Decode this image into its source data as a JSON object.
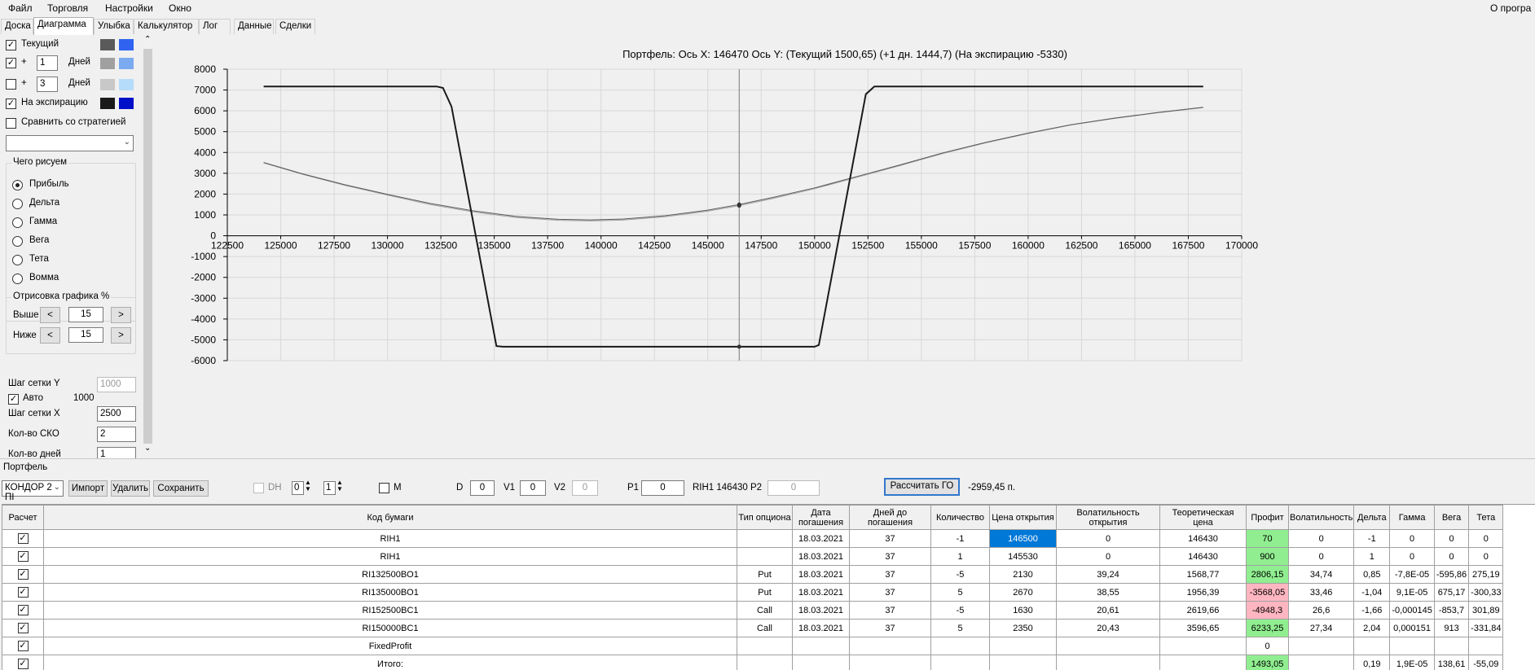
{
  "menu": {
    "items": [
      "Файл",
      "Торговля",
      "Настройки",
      "Окно"
    ],
    "right_text": "О програ"
  },
  "tabs": [
    "Доска",
    "Диаграмма",
    "Улыбка",
    "Калькулятор",
    "Лог",
    "Данные",
    "Сделки"
  ],
  "active_tab": "Диаграмма",
  "left": {
    "current_label": "Текущий",
    "plus_label": "+",
    "days_label": "Дней",
    "days1_value": "1",
    "days2_value": "3",
    "expiry_label": "На экспирацию",
    "compare_label": "Сравнить со стратегией",
    "strategy_combo_value": "",
    "what_group_title": "Чего рисуем",
    "radios": [
      "Прибыль",
      "Дельта",
      "Гамма",
      "Вега",
      "Тета",
      "Вомма"
    ],
    "radio_selected": "Прибыль",
    "draw_group_title": "Отрисовка графика %",
    "above_label": "Выше",
    "below_label": "Ниже",
    "above_value": "15",
    "below_value": "15",
    "dec_glyph": "<",
    "inc_glyph": ">",
    "grid_y_label": "Шаг сетки Y",
    "grid_y_value": "1000",
    "auto_label": "Авто",
    "auto_value": "1000",
    "grid_x_label": "Шаг сетки X",
    "grid_x_value": "2500",
    "sko_label": "Кол-во СКО",
    "sko_value": "2",
    "days_count_label": "Кол-во дней",
    "days_count_value": "1",
    "colors": {
      "current_dark": "#5a5a5a",
      "current_light": "#2f63f0",
      "plus1_dark": "#a0a0a0",
      "plus1_light": "#7aaaf0",
      "plus3_dark": "#c8c8c8",
      "plus3_light": "#b5dcfa",
      "expiry_dark": "#1a1a1a",
      "expiry_light": "#0010c8"
    }
  },
  "chart_title": "Портфель: Ось X: 146470 Ось Y:  (Текущий 1500,65)  (+1 дн. 1444,7)  (На экспирацию -5330)",
  "chart_data": {
    "type": "line",
    "xlim": [
      122500,
      170000
    ],
    "ylim": [
      -6000,
      8000
    ],
    "x_ticks": [
      122500,
      125000,
      127500,
      130000,
      132500,
      135000,
      137500,
      140000,
      142500,
      145000,
      147500,
      150000,
      152500,
      155000,
      157500,
      160000,
      162500,
      165000,
      167500,
      170000
    ],
    "y_ticks": [
      8000,
      7000,
      6000,
      5000,
      4000,
      3000,
      2000,
      1000,
      0,
      -1000,
      -2000,
      -3000,
      -4000,
      -5000,
      -6000
    ],
    "x_tick_labels": [
      "122500",
      "125000",
      "127500",
      "130000",
      "132500",
      "135000",
      "137500",
      "140000",
      "142500",
      "145000",
      "147500",
      "150000",
      "152500",
      "155000",
      "157500",
      "160000",
      "162500",
      "165000",
      "167500",
      "170000"
    ],
    "y_tick_labels": [
      "8000",
      "7000",
      "6000",
      "5000",
      "4000",
      "3000",
      "2000",
      "1000",
      "0",
      "-1000",
      "-2000",
      "-3000",
      "-4000",
      "-5000",
      "-6000"
    ],
    "grid": true,
    "cursor_x": 146470,
    "series": [
      {
        "color": "#1a1a1a",
        "width": 2,
        "x": [
          124200,
          132300,
          132600,
          133000,
          135100,
          135400,
          150000,
          150200,
          152400,
          152800,
          153200,
          168200
        ],
        "y": [
          7170,
          7170,
          7100,
          6200,
          -5300,
          -5330,
          -5330,
          -5250,
          6800,
          7170,
          7170,
          7170
        ]
      },
      {
        "color": "#5a5a5a",
        "width": 1,
        "x": [
          124200,
          126000,
          128000,
          130000,
          132000,
          134000,
          136000,
          138000,
          139500,
          141000,
          143000,
          145000,
          146470,
          148000,
          150000,
          152000,
          154000,
          156000,
          158000,
          160000,
          162000,
          164000,
          166000,
          168200
        ],
        "y": [
          3520,
          2980,
          2450,
          1990,
          1550,
          1200,
          930,
          790,
          760,
          800,
          960,
          1230,
          1500,
          1830,
          2300,
          2850,
          3400,
          3980,
          4480,
          4930,
          5330,
          5640,
          5910,
          6170
        ]
      },
      {
        "color": "#a0a0a0",
        "width": 1,
        "x": [
          124200,
          126000,
          128000,
          130000,
          132000,
          134000,
          136000,
          138000,
          139500,
          141000,
          143000,
          145000,
          146470,
          148000,
          150000,
          152000,
          154000,
          156000,
          158000,
          160000,
          162000,
          164000,
          166000,
          168200
        ],
        "y": [
          3500,
          2960,
          2420,
          1950,
          1500,
          1150,
          880,
          740,
          710,
          750,
          910,
          1180,
          1445,
          1780,
          2260,
          2810,
          3370,
          3950,
          4460,
          4910,
          5320,
          5630,
          5900,
          6160
        ]
      }
    ]
  },
  "portfolio_label": "Портфель",
  "toolbar": {
    "portfolio_combo": "КОНДОР 2 ПІ",
    "import_label": "Импорт",
    "delete_label": "Удалить",
    "save_label": "Сохранить",
    "dh_label": "DH",
    "dh_val1": "0",
    "dh_val2": "1",
    "m_label": "M",
    "d_label": "D",
    "d_value": "0",
    "v1_label": "V1",
    "v1_value": "0",
    "v2_label": "V2",
    "v2_value": "0",
    "p1_label": "P1",
    "p1_value": "0",
    "rih_text": "RIH1 146430",
    "p2_label": "P2",
    "p2_value": "0",
    "calc_label": "Рассчитать ГО",
    "go_value": "-2959,45 п."
  },
  "table": {
    "headers": [
      "Расчет",
      "Код бумаги",
      "Тип опциона",
      "Дата погашения",
      "Дней до погашения",
      "Количество",
      "Цена открытия",
      "Волатильность открытия",
      "Теоретическая цена",
      "Профит",
      "Волатильность",
      "Дельта",
      "Гамма",
      "Вега",
      "Тета"
    ],
    "rows": [
      [
        "✓",
        "RIH1",
        "",
        "18.03.2021",
        "37",
        "-1",
        "146500",
        "0",
        "146430",
        "70",
        "0",
        "-1",
        "0",
        "0",
        "0"
      ],
      [
        "✓",
        "RIH1",
        "",
        "18.03.2021",
        "37",
        "1",
        "145530",
        "0",
        "146430",
        "900",
        "0",
        "1",
        "0",
        "0",
        "0"
      ],
      [
        "✓",
        "RI132500BO1",
        "Put",
        "18.03.2021",
        "37",
        "-5",
        "2130",
        "39,24",
        "1568,77",
        "2806,15",
        "34,74",
        "0,85",
        "-7,8E-05",
        "-595,86",
        "275,19"
      ],
      [
        "✓",
        "RI135000BO1",
        "Put",
        "18.03.2021",
        "37",
        "5",
        "2670",
        "38,55",
        "1956,39",
        "-3568,05",
        "33,46",
        "-1,04",
        "9,1E-05",
        "675,17",
        "-300,33"
      ],
      [
        "✓",
        "RI152500BC1",
        "Call",
        "18.03.2021",
        "37",
        "-5",
        "1630",
        "20,61",
        "2619,66",
        "-4948,3",
        "26,6",
        "-1,66",
        "-0,000145",
        "-853,7",
        "301,89"
      ],
      [
        "✓",
        "RI150000BC1",
        "Call",
        "18.03.2021",
        "37",
        "5",
        "2350",
        "20,43",
        "3596,65",
        "6233,25",
        "27,34",
        "2,04",
        "0,000151",
        "913",
        "-331,84"
      ],
      [
        "✓",
        "FixedProfit",
        "",
        "",
        "",
        "",
        "",
        "",
        "",
        "0",
        "",
        "",
        "",
        "",
        ""
      ],
      [
        "✓",
        "Итого:",
        "",
        "",
        "",
        "",
        "",
        "",
        "",
        "1493,05",
        "",
        "0,19",
        "1,9E-05",
        "138,61",
        "-55,09"
      ]
    ],
    "profit_styles": [
      "green",
      "green",
      "green",
      "red",
      "red",
      "green",
      "",
      "green"
    ]
  }
}
